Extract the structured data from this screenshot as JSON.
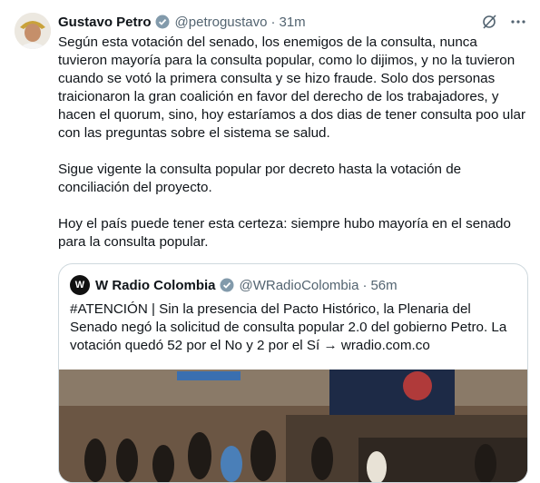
{
  "tweet": {
    "author_name": "Gustavo Petro",
    "handle": "@petrogustavo",
    "separator": "·",
    "time": "31m",
    "paragraphs": [
      "Según esta votación del senado, los enemigos de la consulta, nunca tuvieron mayoría para la consulta popular, como lo dijimos, y no la tuvieron cuando se votó la primera consulta y se hizo fraude. Solo dos personas traicionaron la gran coalición en favor del derecho de los trabajadores, y hacen el quorum, sino, hoy estaríamos a dos dias de tener consulta poo ular con las preguntas sobre el sistema se salud.",
      "Sigue vigente la consulta popular por decreto hasta la votación de conciliación del proyecto.",
      "Hoy el país puede tener esta certeza: siempre hubo mayoría en el senado para la consulta popular."
    ],
    "icons": {
      "verified": "verified-badge-icon",
      "grok": "grok-icon",
      "more": "more-icon"
    }
  },
  "quoted": {
    "logo_text": "W",
    "author_name": "W Radio Colombia",
    "handle": "@WRadioColombia",
    "separator": "·",
    "time": "56m",
    "text": "#ATENCIÓN | Sin la presencia del Pacto Histórico, la Plenaria del Senado negó la solicitud de consulta popular 2.0 del gobierno Petro. La votación quedó 52 por el No y 2 por el Sí → wradio.com.co"
  },
  "colors": {
    "text": "#0f1419",
    "secondary": "#536471",
    "verified": "#829aab",
    "border": "#cfd9de"
  }
}
